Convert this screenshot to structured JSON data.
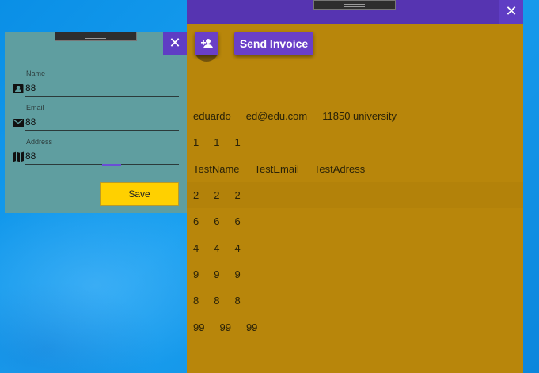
{
  "invoice_window": {
    "close_glyph": "✕",
    "send_invoice_label": "Send Invoice",
    "add_contact_icon": "person-add-icon",
    "rows": [
      [
        "eduardo",
        "ed@edu.com",
        "11850 university"
      ],
      [
        "1",
        "1",
        "1"
      ],
      [
        "TestName",
        "TestEmail",
        "TestAdress"
      ],
      [
        "2",
        "2",
        "2"
      ],
      [
        "6",
        "6",
        "6"
      ],
      [
        "4",
        "4",
        "4"
      ],
      [
        "9",
        "9",
        "9"
      ],
      [
        "8",
        "8",
        "8"
      ],
      [
        "99",
        "99",
        "99"
      ]
    ],
    "selected_row": 3
  },
  "form_window": {
    "close_glyph": "✕",
    "fields": {
      "name": {
        "label": "Name",
        "value": "88",
        "icon": "contact-card-icon"
      },
      "email": {
        "label": "Email",
        "value": "88",
        "icon": "envelope-icon"
      },
      "address": {
        "label": "Address",
        "value": "88",
        "icon": "map-icon"
      }
    },
    "save_label": "Save"
  },
  "colors": {
    "accent_purple": "#5634b1",
    "invoice_bg": "#b8860b",
    "form_bg": "#5f9ea0",
    "save_yellow": "#ffd000"
  }
}
